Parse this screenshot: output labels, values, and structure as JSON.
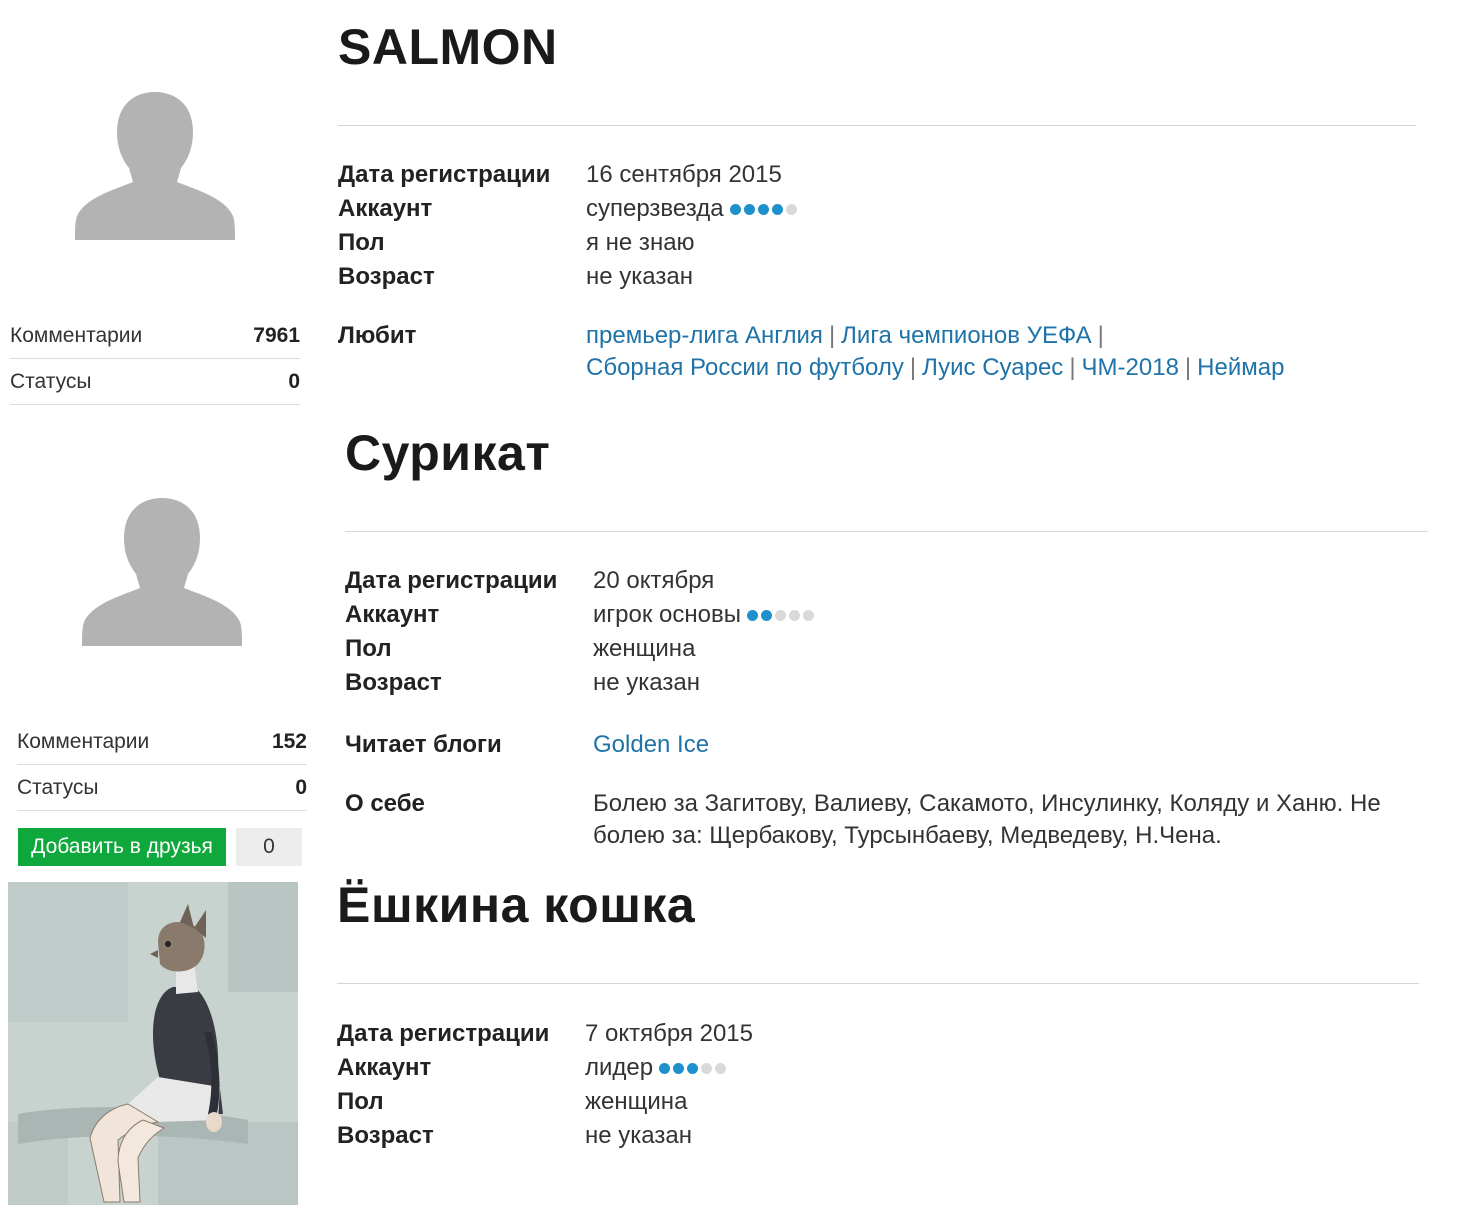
{
  "profiles": [
    {
      "name": "SALMON",
      "stats": {
        "comments_label": "Комментарии",
        "comments": "7961",
        "statuses_label": "Статусы",
        "statuses": "0"
      },
      "reg_label": "Дата регистрации",
      "reg": "16 сентября 2015",
      "acc_label": "Аккаунт",
      "acc": "суперзвезда",
      "acc_level": 4,
      "sex_label": "Пол",
      "sex": "я не знаю",
      "age_label": "Возраст",
      "age": "не указан",
      "likes_label": "Любит",
      "likes": [
        "премьер-лига Англия",
        "Лига чемпионов УЕФА",
        "Сборная России по футболу",
        "Луис Суарес",
        "ЧМ-2018",
        "Неймар"
      ]
    },
    {
      "name": "Сурикат",
      "stats": {
        "comments_label": "Комментарии",
        "comments": "152",
        "statuses_label": "Статусы",
        "statuses": "0"
      },
      "reg_label": "Дата регистрации",
      "reg": "20 октября",
      "acc_label": "Аккаунт",
      "acc": "игрок основы",
      "acc_level": 2,
      "sex_label": "Пол",
      "sex": "женщина",
      "age_label": "Возраст",
      "age": "не указан",
      "blogs_label": "Читает блоги",
      "blogs": "Golden Ice",
      "about_label": "О себе",
      "about": "Болею за Загитову, Валиеву, Сакамото, Инсулинку, Коляду и Ханю. Не болею за: Щербакову, Турсынбаеву, Медведеву, Н.Чена.",
      "add_friend": "Добавить в друзья",
      "friend_count": "0"
    },
    {
      "name": "Ёшкина кошка",
      "reg_label": "Дата регистрации",
      "reg": "7 октября 2015",
      "acc_label": "Аккаунт",
      "acc": "лидер",
      "acc_level": 3,
      "sex_label": "Пол",
      "sex": "женщина",
      "age_label": "Возраст",
      "age": "не указан"
    }
  ],
  "colors": {
    "link": "#2073a8",
    "dot_on": "#1e90cc",
    "dot_off": "#d9d9d9",
    "friend_button": "#0fa83c"
  },
  "icons": {
    "default_avatar": "person-silhouette-icon"
  }
}
